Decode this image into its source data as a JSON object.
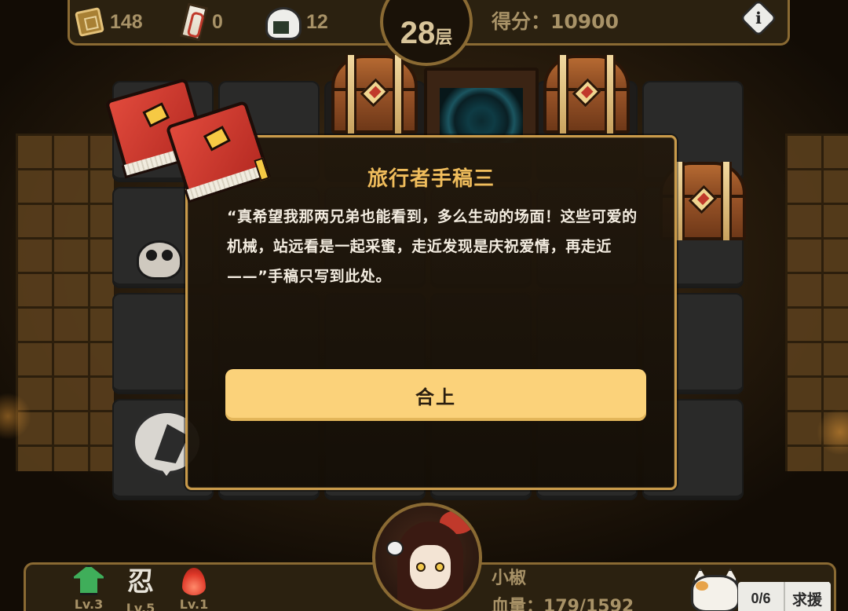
{
  "hud": {
    "gold": "148",
    "tickets": "0",
    "rice_balls": "12",
    "floor_number": "28",
    "floor_unit": "层",
    "score_text": "得分：10900",
    "info_label": "i"
  },
  "dialog": {
    "title": "旅行者手稿三",
    "body": "“真希望我那两兄弟也能看到，多么生动的场面！这些可爱的机械，站远看是一起采蜜，走近发现是庆祝爱情，再走近——”手稿只写到此处。",
    "close_label": "合上"
  },
  "bottom": {
    "skills": [
      {
        "name": "heal",
        "icon": "heal-arrow-icon",
        "level": "Lv.3"
      },
      {
        "name": "ninja",
        "icon": "ninja-kanji-icon",
        "glyph": "忍",
        "level": "Lv.5"
      },
      {
        "name": "fire",
        "icon": "fire-icon",
        "level": "Lv.1"
      }
    ],
    "character_name": "小椒",
    "hp_text": "血量：179/1592",
    "help_count": "0/6",
    "help_label": "求援"
  },
  "colors": {
    "accent_gold": "#f0bd5c",
    "button_yellow": "#fbd27a",
    "hud_text": "#a89267",
    "frame": "#c99a4a"
  }
}
